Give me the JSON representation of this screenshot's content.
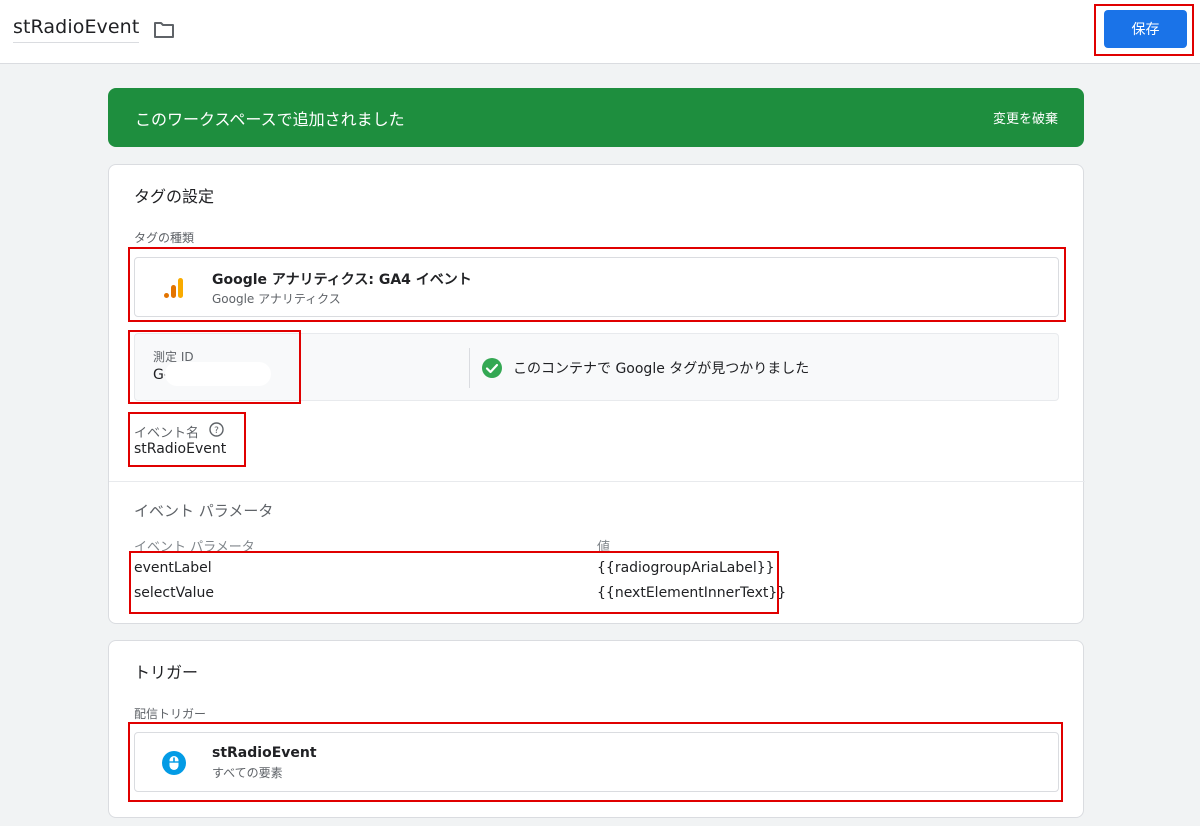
{
  "header": {
    "title": "stRadioEvent",
    "save_label": "保存"
  },
  "banner": {
    "message": "このワークスペースで追加されました",
    "discard_label": "変更を破棄"
  },
  "tag_config": {
    "heading": "タグの設定",
    "type_label": "タグの種類",
    "type_name": "Google アナリティクス: GA4 イベント",
    "type_sub": "Google アナリティクス",
    "measurement_label": "測定 ID",
    "measurement_value": "G-[",
    "google_tag_status": "このコンテナで Google タグが見つかりました",
    "event_name_label": "イベント名",
    "event_name_value": "stRadioEvent",
    "params_heading": "イベント パラメータ",
    "params_col_name": "イベント パラメータ",
    "params_col_value": "値",
    "params": [
      {
        "name": "eventLabel",
        "value": "{{radiogroupAriaLabel}}"
      },
      {
        "name": "selectValue",
        "value": "{{nextElementInnerText}}"
      }
    ]
  },
  "trigger": {
    "heading": "トリガー",
    "firing_label": "配信トリガー",
    "name": "stRadioEvent",
    "sub": "すべての要素"
  },
  "colors": {
    "accent": "#1a73e8",
    "banner_green": "#1e8e3e",
    "highlight_red": "#e00000",
    "success_green": "#34a853",
    "analytics_orange": "#f9ab00",
    "trigger_blue": "#039be5"
  },
  "icons": [
    "folder-icon",
    "analytics-icon",
    "check-circle-icon",
    "help-icon",
    "click-trigger-icon"
  ]
}
